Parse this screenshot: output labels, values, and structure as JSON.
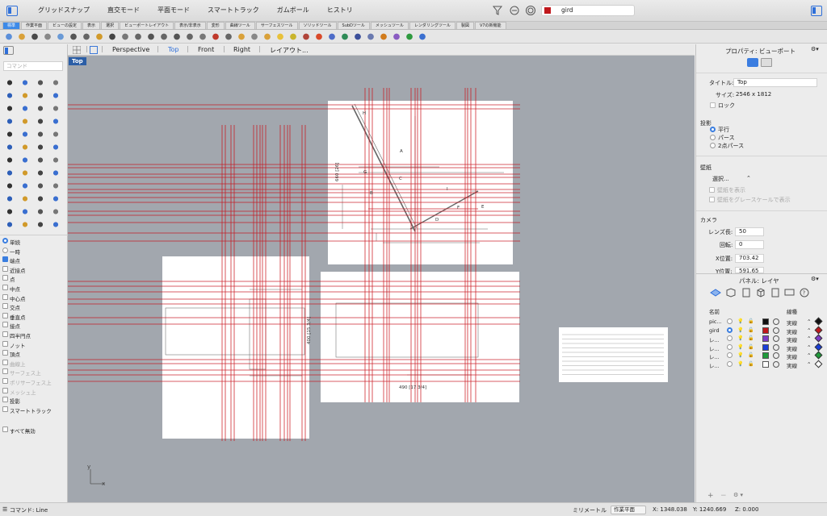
{
  "titlebar": {
    "menus": [
      "グリッドスナップ",
      "直交モード",
      "平面モード",
      "スマートトラック",
      "ガムボール",
      "ヒストリ"
    ],
    "current_layer": "gird",
    "current_layer_color": "#c0181c"
  },
  "tabs": [
    "標準",
    "作業平面",
    "ビューの設定",
    "表示",
    "選択",
    "ビューポートレイアウト",
    "表示/非表示",
    "変形",
    "曲線ツール",
    "サーフェスツール",
    "ソリッドツール",
    "SubDツール",
    "メッシュツール",
    "レンダリングツール",
    "製図",
    "V7の新機能"
  ],
  "toolbar_icons": [
    "new-file-icon",
    "open-folder-icon",
    "save-icon",
    "print-icon",
    "import-icon",
    "cut-icon",
    "copy-icon",
    "paste-icon",
    "undo-icon",
    "pan-hand-icon",
    "rotate-view-icon",
    "zoom-icon",
    "zoom-window-icon",
    "zoom-extents-icon",
    "zoom-selected-icon",
    "grid-icon",
    "car-icon",
    "eye-icon",
    "paint-bucket-icon",
    "select-icon",
    "layer-icon",
    "bulb-icon",
    "lock-icon",
    "mat-icon",
    "render-icon",
    "sphere-icon",
    "env-icon",
    "sphere2-icon",
    "sphere3-icon",
    "filter-icon",
    "brush-icon",
    "green-icon",
    "help-icon"
  ],
  "viewport_tabs": [
    "Perspective",
    "Top",
    "Front",
    "Right",
    "レイアウト..."
  ],
  "active_viewport": "Top",
  "viewport_label": "Top",
  "command_placeholder": "コマンド",
  "osnap": {
    "mode": [
      {
        "label": "単続",
        "on": true
      },
      {
        "label": "一時",
        "on": false
      }
    ],
    "items": [
      {
        "label": "端点",
        "on": true,
        "enabled": true
      },
      {
        "label": "近接点",
        "on": false,
        "enabled": true
      },
      {
        "label": "点",
        "on": false,
        "enabled": true
      },
      {
        "label": "中点",
        "on": false,
        "enabled": true
      },
      {
        "label": "中心点",
        "on": false,
        "enabled": true
      },
      {
        "label": "交点",
        "on": false,
        "enabled": true
      },
      {
        "label": "垂直点",
        "on": false,
        "enabled": true
      },
      {
        "label": "接点",
        "on": false,
        "enabled": true
      },
      {
        "label": "四半円点",
        "on": false,
        "enabled": true
      },
      {
        "label": "ノット",
        "on": false,
        "enabled": true
      },
      {
        "label": "頂点",
        "on": false,
        "enabled": true
      },
      {
        "label": "曲線上",
        "on": false,
        "enabled": false
      },
      {
        "label": "サーフェス上",
        "on": false,
        "enabled": false
      },
      {
        "label": "ポリサーフェス上",
        "on": false,
        "enabled": false
      },
      {
        "label": "メッシュ上",
        "on": false,
        "enabled": false
      },
      {
        "label": "投影",
        "on": false,
        "enabled": true
      },
      {
        "label": "スマートトラック",
        "on": false,
        "enabled": true
      }
    ],
    "disable_all": "すべて無効"
  },
  "properties": {
    "header": "プロパティ: ビューポート",
    "title_label": "タイトル:",
    "title_value": "Top",
    "size_label": "サイズ:",
    "size_value": "2546 x 1812",
    "lock_label": "ロック",
    "projection_heading": "投影",
    "projection_options": [
      "平行",
      "パース",
      "2点パース"
    ],
    "wallpaper_heading": "壁紙",
    "wallpaper_select": "選択...",
    "wallpaper_show": "壁紙を表示",
    "wallpaper_gray": "壁紙をグレースケールで表示",
    "camera_heading": "カメラ",
    "lens_label": "レンズ長:",
    "lens_value": "50",
    "rotation_label": "回転:",
    "rotation_value": "0",
    "xpos_label": "X位置:",
    "xpos_value": "703.42",
    "ypos_label": "Y位置:",
    "ypos_value": "591.65"
  },
  "layers_panel": {
    "header": "パネル: レイヤ",
    "col_name": "名前",
    "col_linetype": "線種",
    "rows": [
      {
        "name": "pic...",
        "current": false,
        "color": "#111111",
        "linetype": "実線",
        "print_color": "#111111"
      },
      {
        "name": "gird",
        "current": true,
        "color": "#c0181c",
        "linetype": "実線",
        "print_color": "#c0181c"
      },
      {
        "name": "レ...",
        "current": false,
        "color": "#7d3cc6",
        "linetype": "実線",
        "print_color": "#7d3cc6"
      },
      {
        "name": "レ...",
        "current": false,
        "color": "#1a3fd8",
        "linetype": "実線",
        "print_color": "#1a3fd8"
      },
      {
        "name": "レ...",
        "current": false,
        "color": "#1f9a3a",
        "linetype": "実線",
        "print_color": "#1f9a3a"
      },
      {
        "name": "レ...",
        "current": false,
        "color": "#ffffff",
        "linetype": "実線",
        "print_color": "#ffffff"
      }
    ]
  },
  "status": {
    "command": "コマンド: Line",
    "units": "ミリメートル",
    "cplane": "作業平面",
    "x": "X: 1348.038",
    "y": "Y: 1240.669",
    "z": "Z: 0.000"
  },
  "drawing_labels": {
    "letters": [
      "H",
      "A",
      "G",
      "C",
      "B",
      "I",
      "F",
      "E",
      "D"
    ],
    "dims": [
      "660 [26]",
      "400 [15 3/4]",
      "490 [17 3/4]"
    ],
    "axis_x": "x",
    "axis_y": "y"
  }
}
